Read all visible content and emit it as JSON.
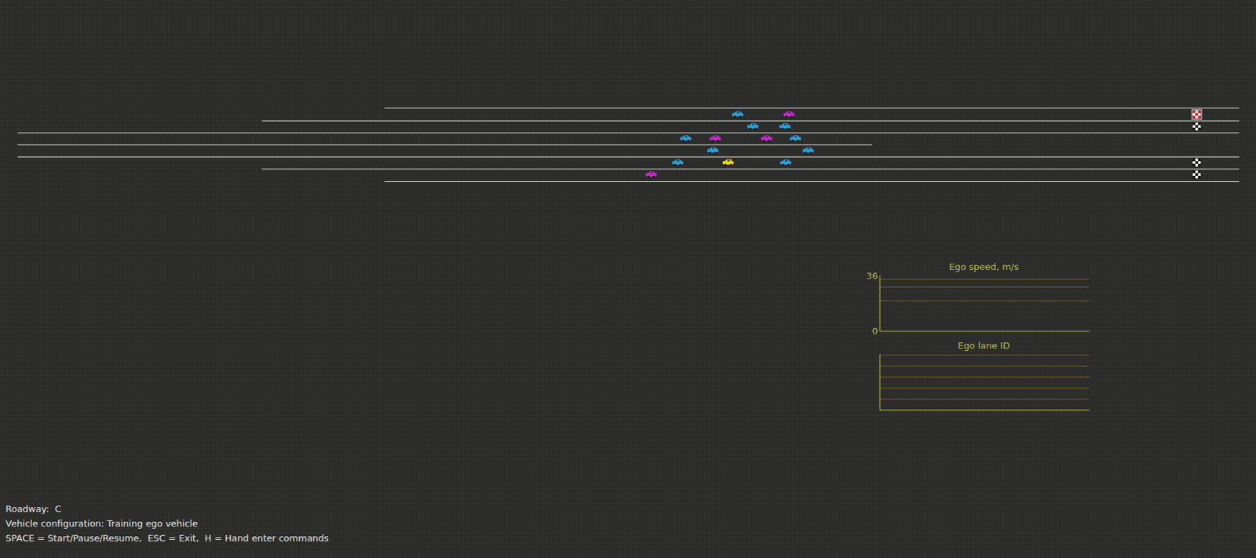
{
  "road": {
    "cars": [
      {
        "lane": 1,
        "kind": "traffic",
        "color": "#2a9fd6"
      },
      {
        "lane": 1,
        "kind": "traffic",
        "color": "#c52ac8"
      },
      {
        "lane": 2,
        "kind": "traffic",
        "color": "#2a9fd6"
      },
      {
        "lane": 2,
        "kind": "traffic",
        "color": "#2a9fd6"
      },
      {
        "lane": 3,
        "kind": "traffic",
        "color": "#2a9fd6"
      },
      {
        "lane": 3,
        "kind": "traffic",
        "color": "#c52ac8"
      },
      {
        "lane": 3,
        "kind": "traffic",
        "color": "#c52ac8"
      },
      {
        "lane": 3,
        "kind": "traffic",
        "color": "#2a9fd6"
      },
      {
        "lane": 4,
        "kind": "traffic",
        "color": "#2a9fd6"
      },
      {
        "lane": 4,
        "kind": "traffic",
        "color": "#2a9fd6"
      },
      {
        "lane": 5,
        "kind": "traffic",
        "color": "#2a9fd6"
      },
      {
        "lane": 5,
        "kind": "ego",
        "color": "#e8d21c"
      },
      {
        "lane": 5,
        "kind": "traffic",
        "color": "#2a9fd6"
      },
      {
        "lane": 6,
        "kind": "traffic",
        "color": "#c52ac8"
      }
    ],
    "targets": [
      {
        "lane": 1,
        "selected": true,
        "color": "#d42a2a"
      },
      {
        "lane": 2,
        "selected": false,
        "color": "#111111"
      },
      {
        "lane": 5,
        "selected": false,
        "color": "#111111"
      },
      {
        "lane": 6,
        "selected": false,
        "color": "#111111"
      }
    ]
  },
  "charts": [
    {
      "title": "Ego speed, m/s",
      "ticks": [
        "36",
        "0"
      ],
      "min": 0,
      "max": 36,
      "gridlines": [
        34,
        29,
        20
      ]
    },
    {
      "title": "Ego lane ID",
      "ticks": [],
      "min": 1,
      "max": 6,
      "gridlines": [
        1,
        2,
        3,
        4,
        5,
        6
      ]
    }
  ],
  "footer": [
    "Roadway:  C",
    "Vehicle configuration: Training ego vehicle",
    "SPACE = Start/Pause/Resume,  ESC = Exit,  H = Hand enter commands"
  ]
}
